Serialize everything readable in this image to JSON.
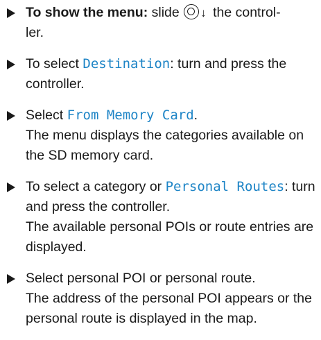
{
  "steps": [
    {
      "lead": "To show the menu:",
      "text_a": " slide ",
      "arrow": "↓",
      "text_b": " the control-",
      "text_c": "ler."
    },
    {
      "pre": "To select ",
      "term": "Destination",
      "post": ": turn and press the controller."
    },
    {
      "pre": "Select ",
      "term": "From Memory Card",
      "post": ".",
      "result": "The menu displays the categories available on the SD memory card."
    },
    {
      "pre": "To select a category or ",
      "term": "Personal Routes",
      "post": ": turn and press the controller.",
      "result": "The available personal POIs or route entries are displayed."
    },
    {
      "text": "Select personal POI or personal route.",
      "result": "The address of the personal POI appears or the personal route is displayed in the map."
    }
  ],
  "icons": {
    "bullet": "triangle-right-icon",
    "controller": "controller-icon",
    "slide_down": "arrow-down-icon"
  },
  "colors": {
    "term": "#1d84c6",
    "text": "#1a1a1a"
  }
}
